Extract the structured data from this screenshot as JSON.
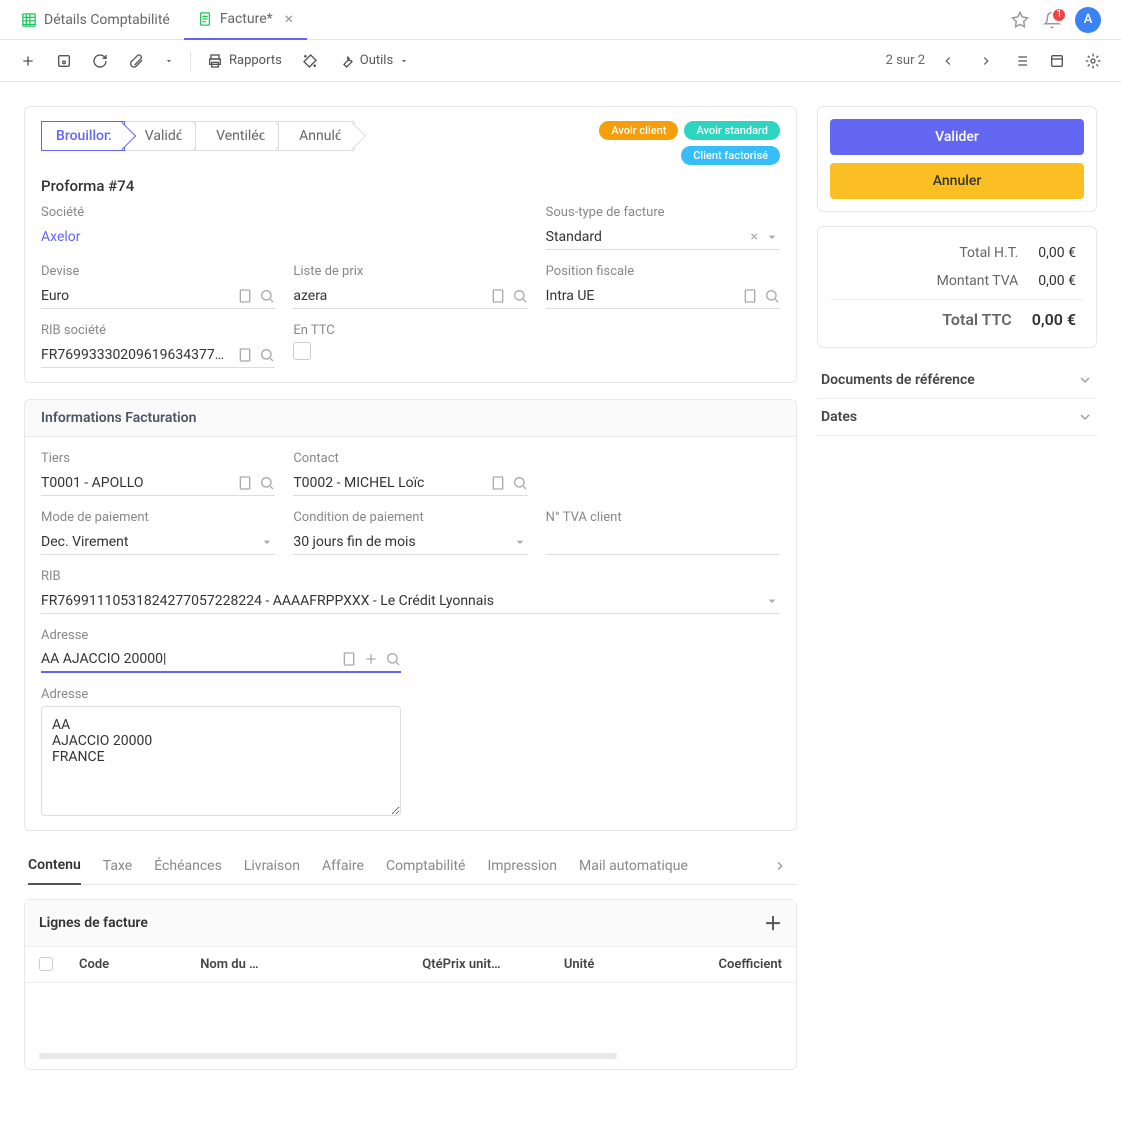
{
  "tabs": [
    {
      "icon": "grid",
      "label": "Détails Comptabilité",
      "active": false
    },
    {
      "icon": "doc",
      "label": "Facture*",
      "active": true
    }
  ],
  "notification_count": "1",
  "avatar_letter": "A",
  "toolbar": {
    "rapports": "Rapports",
    "outils": "Outils",
    "pager": "2 sur 2"
  },
  "status_steps": [
    "Brouillon",
    "Validé",
    "Ventilée",
    "Annulé"
  ],
  "status_active": 0,
  "badges": [
    "Avoir client",
    "Avoir standard",
    "Client factorisé"
  ],
  "proforma": "Proforma #74",
  "fields": {
    "societe_label": "Société",
    "societe_value": "Axelor",
    "sous_type_label": "Sous-type de facture",
    "sous_type_value": "Standard",
    "devise_label": "Devise",
    "devise_value": "Euro",
    "liste_prix_label": "Liste de prix",
    "liste_prix_value": "azera",
    "position_label": "Position fiscale",
    "position_value": "Intra UE",
    "rib_soc_label": "RIB société",
    "rib_soc_value": "FR76993330209619634377…",
    "en_ttc_label": "En TTC"
  },
  "section_info": "Informations Facturation",
  "billing": {
    "tiers_label": "Tiers",
    "tiers_value": "T0001 - APOLLO",
    "contact_label": "Contact",
    "contact_value": "T0002 - MICHEL Loïc",
    "mode_label": "Mode de paiement",
    "mode_value": "Dec. Virement",
    "cond_label": "Condition de paiement",
    "cond_value": "30 jours fin de mois",
    "tva_label": "N° TVA client",
    "tva_value": "",
    "rib_label": "RIB",
    "rib_value": "FR76991110531824277057228224 - AAAAFRPPXXX - Le Crédit Lyonnais",
    "adresse_label": "Adresse",
    "adresse_value": "AA AJACCIO 20000|",
    "adresse2_label": "Adresse",
    "adresse2_value": "AA\nAJACCIO 20000\nFRANCE"
  },
  "actions": {
    "valider": "Valider",
    "annuler": "Annuler"
  },
  "totals": {
    "ht_label": "Total H.T.",
    "ht_value": "0,00 €",
    "tva_label": "Montant TVA",
    "tva_value": "0,00 €",
    "ttc_label": "Total TTC",
    "ttc_value": "0,00 €"
  },
  "accordions": [
    "Documents de référence",
    "Dates"
  ],
  "sub_tabs": [
    "Contenu",
    "Taxe",
    "Échéances",
    "Livraison",
    "Affaire",
    "Comptabilité",
    "Impression",
    "Mail automatique"
  ],
  "lines": {
    "title": "Lignes de facture",
    "cols": [
      "Code",
      "Nom du …",
      "Qté",
      "Prix unit…",
      "Unité",
      "Coefficient"
    ]
  }
}
